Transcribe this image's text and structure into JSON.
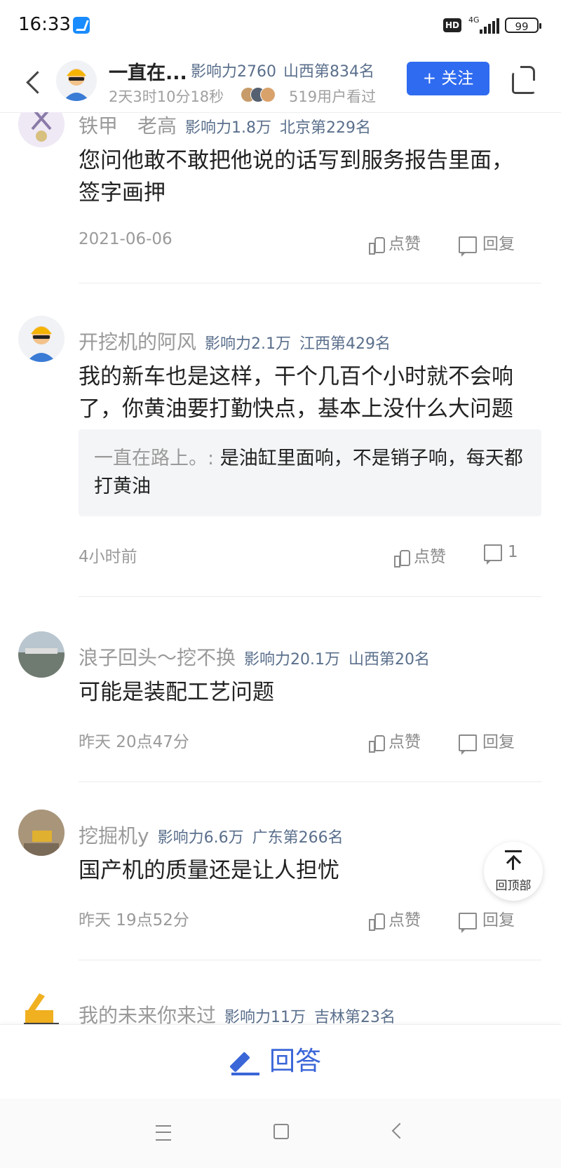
{
  "status_bar": {
    "time": "16:33",
    "hd": "HD",
    "network": "4G",
    "battery": "99"
  },
  "header": {
    "author_name": "一直在...",
    "influence": "影响力2760",
    "rank": "山西第834名",
    "elapsed": "2天3时10分18秒",
    "views": "519用户看过",
    "follow_label": "+ 关注"
  },
  "comments": [
    {
      "user": "铁甲　老高",
      "influence": "影响力1.8万",
      "rank": "北京第229名",
      "text": "您问他敢不敢把他说的话写到服务报告里面，签字画押",
      "time": "2021-06-06",
      "like_label": "点赞",
      "reply_label": "回复"
    },
    {
      "user": "开挖机的阿风",
      "influence": "影响力2.1万",
      "rank": "江西第429名",
      "text": "我的新车也是这样，干个几百个小时就不会响了，你黄油要打勤快点，基本上没什么大问题",
      "quote_name": "一直在路上。:",
      "quote_text": "是油缸里面响，不是销子响，每天都打黄油",
      "time": "4小时前",
      "like_label": "点赞",
      "reply_label": "1"
    },
    {
      "user": "浪子回头～挖不换",
      "influence": "影响力20.1万",
      "rank": "山西第20名",
      "text": "可能是装配工艺问题",
      "time": "昨天 20点47分",
      "like_label": "点赞",
      "reply_label": "回复"
    },
    {
      "user": "挖掘机y",
      "influence": "影响力6.6万",
      "rank": "广东第266名",
      "text": "国产机的质量还是让人担忧",
      "time": "昨天 19点52分",
      "like_label": "点赞",
      "reply_label": "回复"
    },
    {
      "user": "我的未来你来过",
      "influence": "影响力11万",
      "rank": "吉林第23名"
    }
  ],
  "back_to_top_label": "回顶部",
  "answer_label": "回答",
  "colors": {
    "accent": "#2f6bf0",
    "answer": "#3a66d8",
    "meta": "#5a6f8c"
  }
}
